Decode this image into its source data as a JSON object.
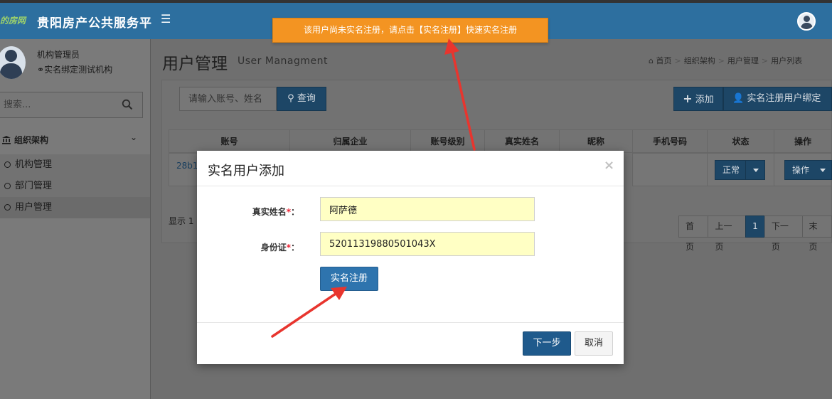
{
  "header": {
    "logo_text": "的房网",
    "app_title": "贵阳房产公共服务平",
    "menu_icon": "hamburger-icon",
    "user_icon": "user-avatar-icon"
  },
  "sidebar": {
    "user_role": "机构管理员",
    "user_org": "实名绑定测试机构",
    "search_placeholder": "搜索...",
    "group_label": "组织架构",
    "items": [
      {
        "label": "机构管理"
      },
      {
        "label": "部门管理"
      },
      {
        "label": "用户管理"
      }
    ]
  },
  "page": {
    "title": "用户管理",
    "subtitle": "User Managment",
    "breadcrumb": [
      "首页",
      "组织架构",
      "用户管理",
      "用户列表"
    ]
  },
  "toolbar": {
    "keyword_placeholder": "请输入账号、姓名",
    "query_label": "查询",
    "add_label": "添加",
    "bind_label": "实名注册用户绑定"
  },
  "table": {
    "columns": [
      "账号",
      "归属企业",
      "账号级别",
      "真实姓名",
      "昵称",
      "手机号码",
      "状态",
      "操作"
    ],
    "row": {
      "account": "28b1",
      "status": "正常",
      "action": "操作"
    },
    "showing": "显示 1 ≡"
  },
  "pagination": {
    "first": "首页",
    "prev": "上一页",
    "current": "1",
    "next": "下一页",
    "last": "末页"
  },
  "toast": {
    "message": "该用户尚未实名注册，请点击【实名注册】快速实名注册"
  },
  "modal": {
    "title": "实名用户添加",
    "close": "×",
    "name_label": "真实姓名",
    "name_value": "阿萨德",
    "id_label": "身份证",
    "id_value": "52011319880501043X",
    "required_mark": "*",
    "colon": "：",
    "realname_button": "实名注册",
    "next_button": "下一步",
    "cancel_button": "取消"
  },
  "colors": {
    "header": "#2d6f9f",
    "toast": "#f39422",
    "primary": "#2e74ae",
    "input_highlight": "#ffffc4",
    "arrow": "#e8352e"
  }
}
